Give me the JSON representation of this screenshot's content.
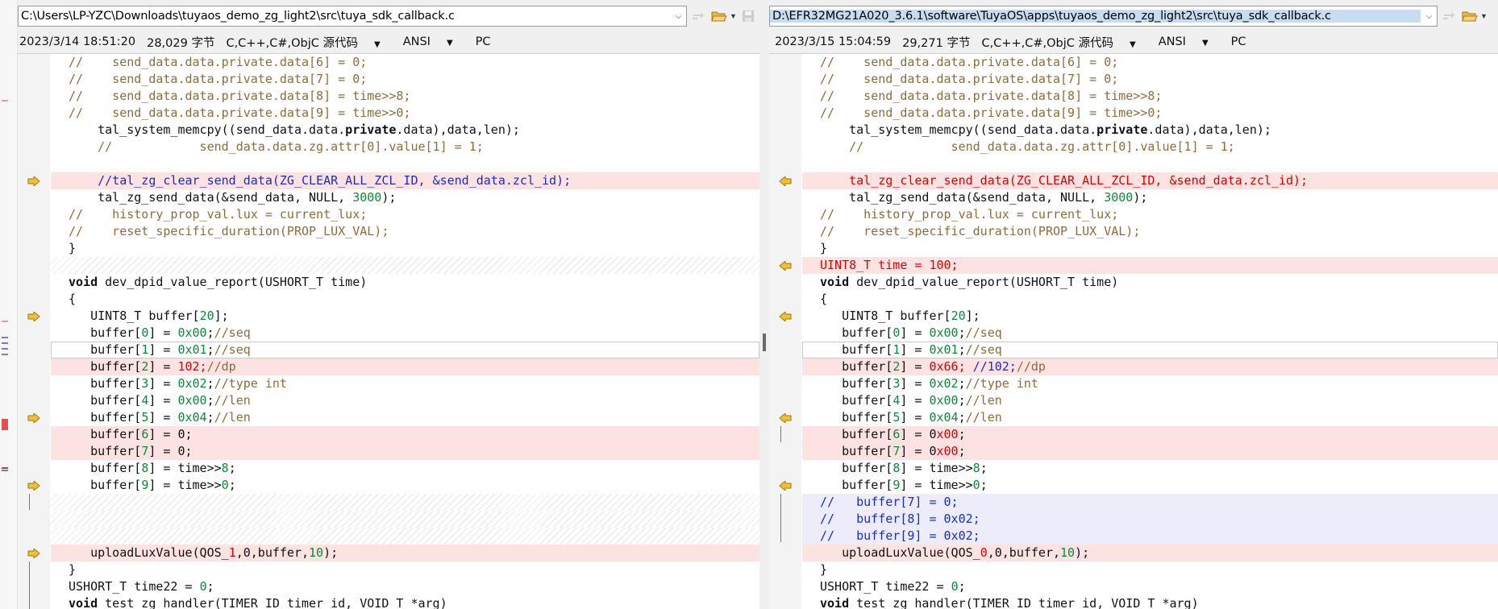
{
  "left": {
    "path": "C:\\Users\\LP-YZC\\Downloads\\tuyaos_demo_zg_light2\\src\\tuya_sdk_callback.c",
    "info": {
      "date": "2023/3/14 18:51:20",
      "size": "28,029 字节",
      "lang": "C,C++,C#,ObjC 源代码",
      "encoding": "ANSI",
      "lineend": "PC"
    }
  },
  "right": {
    "path": "D:\\EFR32MG21A020_3.6.1\\software\\TuyaOS\\apps\\tuyaos_demo_zg_light2\\src\\tuya_sdk_callback.c",
    "info": {
      "date": "2023/3/15 15:04:59",
      "size": "29,271 字节",
      "lang": "C,C++,C#,ObjC 源代码",
      "encoding": "ANSI",
      "lineend": "PC"
    }
  },
  "icons": {
    "dropdown": "chevron-down-icon",
    "sync": "sync-arrows-icon",
    "folder": "open-folder-icon",
    "save": "save-disk-icon",
    "diff_left": "diff-arrow-right-icon",
    "diff_right": "diff-arrow-left-icon"
  },
  "colors": {
    "diff_bg": "#fde2e2",
    "added_bg": "#ececfb",
    "comment": "#8a6d3b",
    "blue_comment": "#1a2cd0",
    "changed": "#e00000",
    "number": "#0a8a3a",
    "selection": "#c7dcf0"
  }
}
